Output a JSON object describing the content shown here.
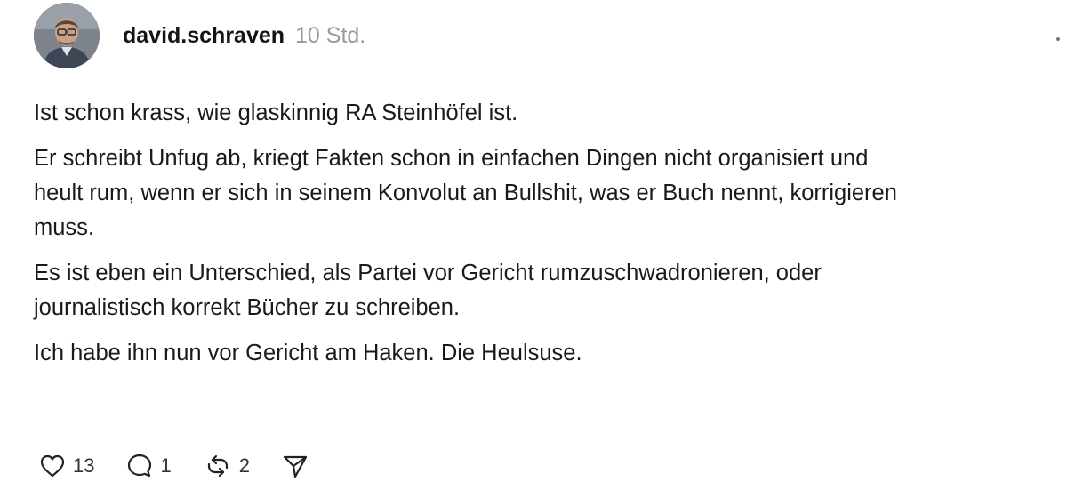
{
  "post": {
    "username": "david.schraven",
    "timestamp": "10 Std.",
    "paragraphs": [
      "Ist schon krass, wie glaskinnig RA Steinhöfel ist.",
      "Er schreibt Unfug ab, kriegt Fakten schon in einfachen Dingen nicht organisiert und\nheult rum, wenn er sich in seinem Konvolut an Bullshit, was er Buch nennt, korrigieren\nmuss.",
      "Es ist eben ein Unterschied, als Partei vor Gericht rumzuschwadronieren, oder\njournalistisch korrekt Bücher zu schreiben.",
      "Ich habe ihn nun vor Gericht am Haken. Die Heulsuse."
    ],
    "actions": {
      "likes": "13",
      "replies": "1",
      "reposts": "2"
    },
    "icons": {
      "like": "heart-icon",
      "reply": "speech-bubble-icon",
      "repost": "repost-icon",
      "share": "send-icon",
      "more": "more-options-icon"
    }
  }
}
